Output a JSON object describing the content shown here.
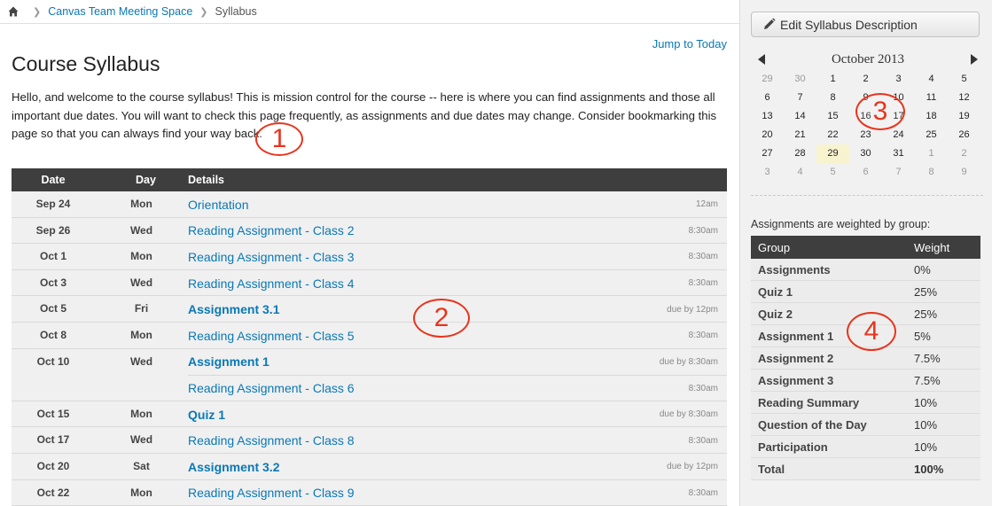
{
  "breadcrumb": {
    "course": "Canvas Team Meeting Space",
    "page": "Syllabus"
  },
  "main": {
    "jump_label": "Jump to Today",
    "title": "Course Syllabus",
    "description": "Hello, and welcome to the course syllabus! This is mission control for the course -- here is where you can find assignments and those all important due dates. You will want to check this page frequently, as assignments and due dates may change. Consider bookmarking this page so that you can always find your way back."
  },
  "syllabus": {
    "headers": {
      "date": "Date",
      "day": "Day",
      "details": "Details"
    },
    "rows": [
      {
        "date": "Sep 24",
        "day": "Mon",
        "items": [
          {
            "title": "Orientation",
            "time": "12am",
            "bold": false
          }
        ]
      },
      {
        "date": "Sep 26",
        "day": "Wed",
        "items": [
          {
            "title": "Reading Assignment - Class 2",
            "time": "8:30am",
            "bold": false
          }
        ]
      },
      {
        "date": "Oct 1",
        "day": "Mon",
        "items": [
          {
            "title": "Reading Assignment - Class 3",
            "time": "8:30am",
            "bold": false
          }
        ]
      },
      {
        "date": "Oct 3",
        "day": "Wed",
        "items": [
          {
            "title": "Reading Assignment - Class 4",
            "time": "8:30am",
            "bold": false
          }
        ]
      },
      {
        "date": "Oct 5",
        "day": "Fri",
        "items": [
          {
            "title": "Assignment 3.1",
            "time": "due by 12pm",
            "bold": true
          }
        ]
      },
      {
        "date": "Oct 8",
        "day": "Mon",
        "items": [
          {
            "title": "Reading Assignment - Class 5",
            "time": "8:30am",
            "bold": false
          }
        ]
      },
      {
        "date": "Oct 10",
        "day": "Wed",
        "items": [
          {
            "title": "Assignment 1",
            "time": "due by 8:30am",
            "bold": true
          },
          {
            "title": "Reading Assignment - Class 6",
            "time": "8:30am",
            "bold": false
          }
        ]
      },
      {
        "date": "Oct 15",
        "day": "Mon",
        "items": [
          {
            "title": "Quiz 1",
            "time": "due by 8:30am",
            "bold": true
          }
        ]
      },
      {
        "date": "Oct 17",
        "day": "Wed",
        "items": [
          {
            "title": "Reading Assignment - Class 8",
            "time": "8:30am",
            "bold": false
          }
        ]
      },
      {
        "date": "Oct 20",
        "day": "Sat",
        "items": [
          {
            "title": "Assignment 3.2",
            "time": "due by 12pm",
            "bold": true
          }
        ]
      },
      {
        "date": "Oct 22",
        "day": "Mon",
        "items": [
          {
            "title": "Reading Assignment - Class 9",
            "time": "8:30am",
            "bold": false
          }
        ]
      }
    ]
  },
  "sidebar": {
    "edit_label": "Edit Syllabus Description",
    "calendar": {
      "month": "October 2013",
      "weeks": [
        [
          {
            "d": "29",
            "o": true
          },
          {
            "d": "30",
            "o": true
          },
          {
            "d": "1"
          },
          {
            "d": "2"
          },
          {
            "d": "3"
          },
          {
            "d": "4"
          },
          {
            "d": "5"
          }
        ],
        [
          {
            "d": "6"
          },
          {
            "d": "7"
          },
          {
            "d": "8"
          },
          {
            "d": "9"
          },
          {
            "d": "10"
          },
          {
            "d": "11"
          },
          {
            "d": "12"
          }
        ],
        [
          {
            "d": "13"
          },
          {
            "d": "14"
          },
          {
            "d": "15"
          },
          {
            "d": "16"
          },
          {
            "d": "17"
          },
          {
            "d": "18"
          },
          {
            "d": "19"
          }
        ],
        [
          {
            "d": "20"
          },
          {
            "d": "21"
          },
          {
            "d": "22"
          },
          {
            "d": "23"
          },
          {
            "d": "24"
          },
          {
            "d": "25"
          },
          {
            "d": "26"
          }
        ],
        [
          {
            "d": "27"
          },
          {
            "d": "28"
          },
          {
            "d": "29",
            "today": true
          },
          {
            "d": "30"
          },
          {
            "d": "31"
          },
          {
            "d": "1",
            "o": true
          },
          {
            "d": "2",
            "o": true
          }
        ],
        [
          {
            "d": "3",
            "o": true
          },
          {
            "d": "4",
            "o": true
          },
          {
            "d": "5",
            "o": true
          },
          {
            "d": "6",
            "o": true
          },
          {
            "d": "7",
            "o": true
          },
          {
            "d": "8",
            "o": true
          },
          {
            "d": "9",
            "o": true
          }
        ]
      ]
    },
    "weights_label": "Assignments are weighted by group:",
    "weights_headers": {
      "group": "Group",
      "weight": "Weight"
    },
    "weights": [
      {
        "group": "Assignments",
        "weight": "0%"
      },
      {
        "group": "Quiz 1",
        "weight": "25%"
      },
      {
        "group": "Quiz 2",
        "weight": "25%"
      },
      {
        "group": "Assignment 1",
        "weight": "5%"
      },
      {
        "group": "Assignment 2",
        "weight": "7.5%"
      },
      {
        "group": "Assignment 3",
        "weight": "7.5%"
      },
      {
        "group": "Reading Summary",
        "weight": "10%"
      },
      {
        "group": "Question of the Day",
        "weight": "10%"
      },
      {
        "group": "Participation",
        "weight": "10%"
      },
      {
        "group": "Total",
        "weight": "100%"
      }
    ]
  },
  "callouts": [
    "1",
    "2",
    "3",
    "4"
  ],
  "colors": {
    "link": "#0a78b5",
    "header": "#3e3e3e",
    "callout": "#e8341c",
    "today": "#f8f3cf"
  }
}
